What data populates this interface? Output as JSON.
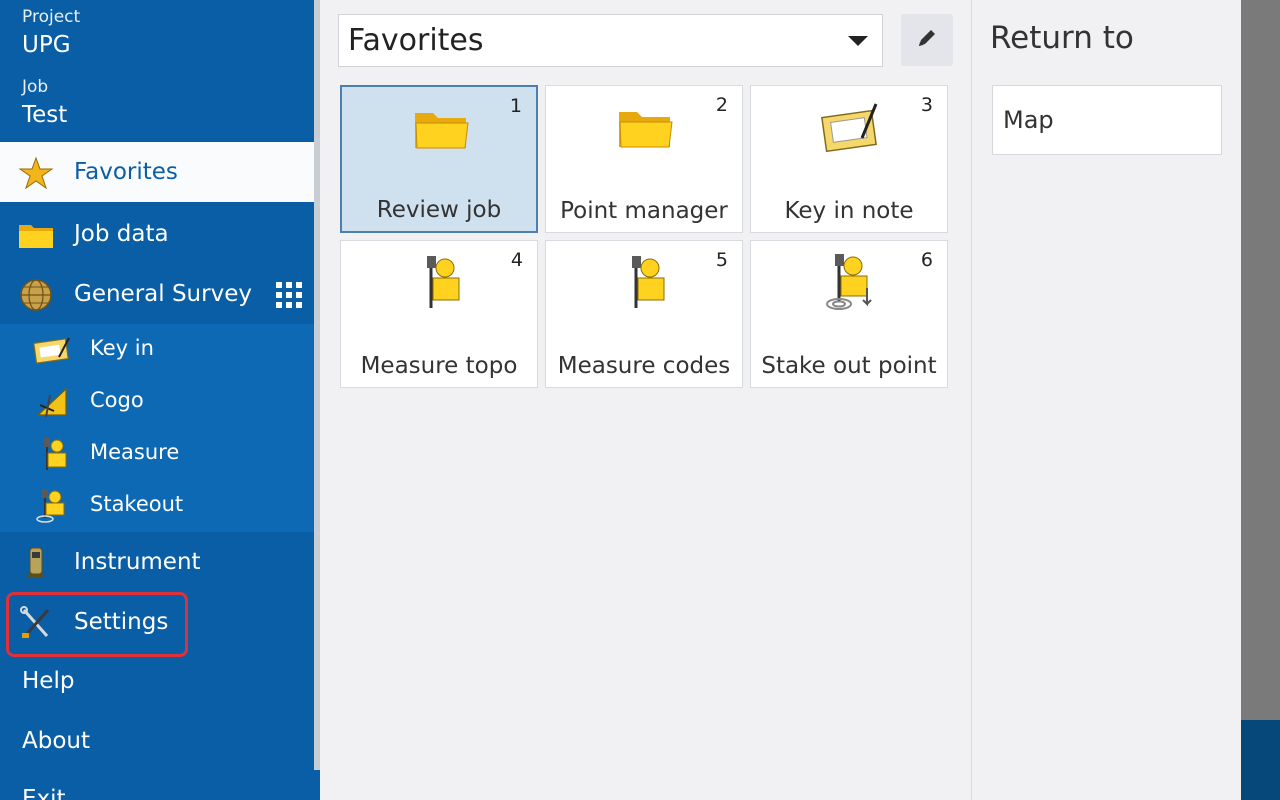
{
  "sidebar": {
    "project_label": "Project",
    "project_value": "UPG",
    "job_label": "Job",
    "job_value": "Test",
    "favorites_label": "Favorites",
    "job_data_label": "Job data",
    "general_survey_label": "General Survey",
    "sub_items": [
      {
        "label": "Key in",
        "icon": "keyin-icon"
      },
      {
        "label": "Cogo",
        "icon": "cogo-icon"
      },
      {
        "label": "Measure",
        "icon": "measure-icon"
      },
      {
        "label": "Stakeout",
        "icon": "stakeout-icon"
      }
    ],
    "instrument_label": "Instrument",
    "settings_label": "Settings",
    "help_label": "Help",
    "about_label": "About",
    "exit_label": "Exit",
    "highlight_color": "#e0303a",
    "background_color": "#0a5ea6"
  },
  "main": {
    "dropdown_value": "Favorites",
    "tiles": [
      {
        "num": "1",
        "name": "Review job",
        "icon": "folder-icon",
        "selected": true
      },
      {
        "num": "2",
        "name": "Point manager",
        "icon": "folder-icon",
        "selected": false
      },
      {
        "num": "3",
        "name": "Key in note",
        "icon": "keyin-note-icon",
        "selected": false
      },
      {
        "num": "4",
        "name": "Measure topo",
        "icon": "surveyor-icon",
        "selected": false
      },
      {
        "num": "5",
        "name": "Measure codes",
        "icon": "surveyor-icon",
        "selected": false
      },
      {
        "num": "6",
        "name": "Stake out point",
        "icon": "stakeout-surveyor-icon",
        "selected": false
      }
    ]
  },
  "return_to": {
    "title": "Return to",
    "items": [
      "Map"
    ]
  }
}
